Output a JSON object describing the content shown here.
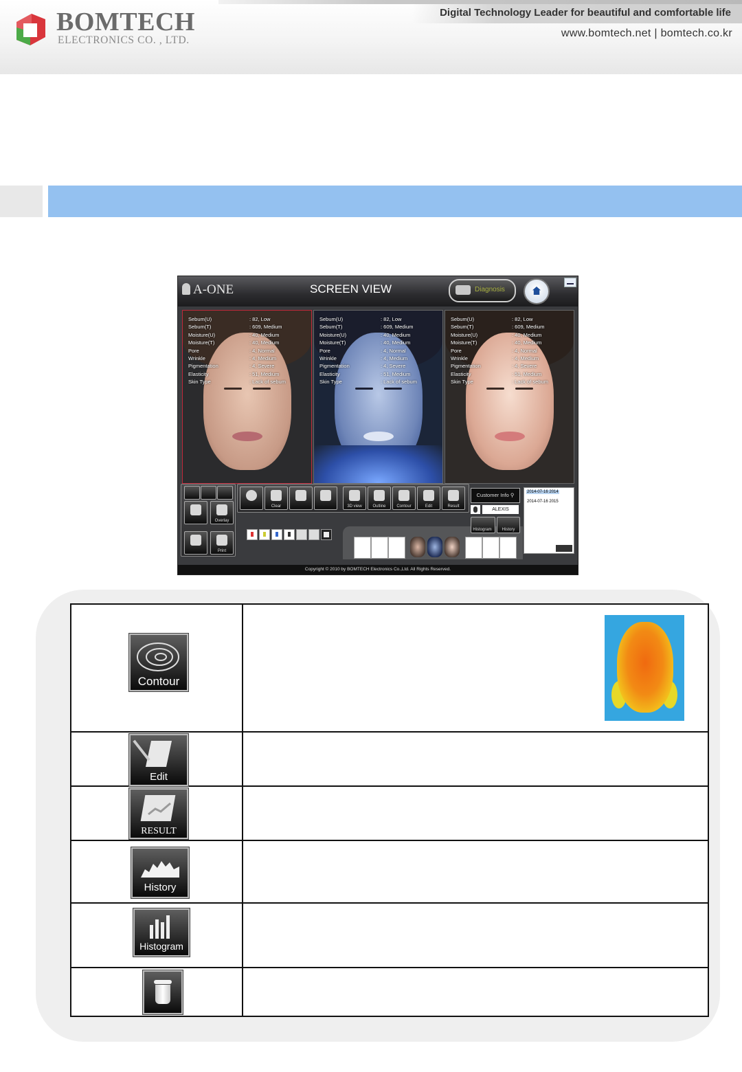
{
  "header": {
    "brand": "BOMTECH",
    "brand_sub": "ELECTRONICS CO. , LTD.",
    "slogan": "Digital Technology Leader for beautiful and comfortable life",
    "sites": "www.bomtech.net | bomtech.co.kr"
  },
  "screenshot": {
    "app_name": "A-ONE",
    "title": "SCREEN VIEW",
    "diagnosis_label": "Diagnosis",
    "panels": [
      {
        "rows": [
          {
            "k": "Sebum(U)",
            "v": ": 82, Low"
          },
          {
            "k": "Sebum(T)",
            "v": ": 609, Medium"
          },
          {
            "k": "Moisture(U)",
            "v": ": 40, Medium"
          },
          {
            "k": "Moisture(T)",
            "v": ": 40, Medium"
          },
          {
            "k": "Pore",
            "v": ": 4, Normal"
          },
          {
            "k": "Wrinkle",
            "v": ": 4, Medium"
          },
          {
            "k": "Pigmentation",
            "v": ": 4, Severe"
          },
          {
            "k": "Elasticity",
            "v": ": 51, Medium"
          },
          {
            "k": "Skin Type",
            "v": ": Lack of sebum"
          }
        ]
      },
      {
        "rows": [
          {
            "k": "Sebum(U)",
            "v": ": 82, Low"
          },
          {
            "k": "Sebum(T)",
            "v": ": 609, Medium"
          },
          {
            "k": "Moisture(U)",
            "v": ": 40, Medium"
          },
          {
            "k": "Moisture(T)",
            "v": ": 40, Medium"
          },
          {
            "k": "Pore",
            "v": ": 4, Normal"
          },
          {
            "k": "Wrinkle",
            "v": ": 4, Medium"
          },
          {
            "k": "Pigmentation",
            "v": ": 4, Severe"
          },
          {
            "k": "Elasticity",
            "v": ": 51, Medium"
          },
          {
            "k": "Skin Type",
            "v": ": Lack of sebum"
          }
        ]
      },
      {
        "rows": [
          {
            "k": "Sebum(U)",
            "v": ": 82, Low"
          },
          {
            "k": "Sebum(T)",
            "v": ": 609, Medium"
          },
          {
            "k": "Moisture(U)",
            "v": ": 40, Medium"
          },
          {
            "k": "Moisture(T)",
            "v": ": 40, Medium"
          },
          {
            "k": "Pore",
            "v": ": 4, Normal"
          },
          {
            "k": "Wrinkle",
            "v": ": 4, Medium"
          },
          {
            "k": "Pigmentation",
            "v": ": 4, Severe"
          },
          {
            "k": "Elasticity",
            "v": ": 51, Medium"
          },
          {
            "k": "Skin Type",
            "v": ": Lack of sebum"
          }
        ]
      }
    ],
    "toolbar": {
      "clear": "Clear",
      "overlay": "Overlay",
      "print": "Print",
      "view3d": "3D view",
      "outline": "Outline",
      "contour": "Contour",
      "edit": "Edit",
      "result": "Result",
      "histogram": "Histogram",
      "history": "History"
    },
    "customer_info": "Customer Info",
    "customer_name": "ALEXIS",
    "dates": [
      "2014-07-16 2014",
      "2014-07-16 2015"
    ],
    "copyright": "Copyright © 2010 by BOMTECH Electronics Co.,Ltd. All Rights Reserved."
  },
  "table": {
    "rows": [
      {
        "icon": "contour-icon",
        "label": "Contour",
        "description": ""
      },
      {
        "icon": "edit-icon",
        "label": "Edit",
        "description": ""
      },
      {
        "icon": "result-icon",
        "label": "RESULT",
        "description": ""
      },
      {
        "icon": "history-icon",
        "label": "History",
        "description": ""
      },
      {
        "icon": "histogram-icon",
        "label": "Histogram",
        "description": ""
      },
      {
        "icon": "trash-icon",
        "label": "",
        "description": ""
      }
    ]
  },
  "colors": {
    "section_bar": "#94c1f0",
    "logo_red": "#d9363c",
    "logo_green": "#4caa48"
  }
}
